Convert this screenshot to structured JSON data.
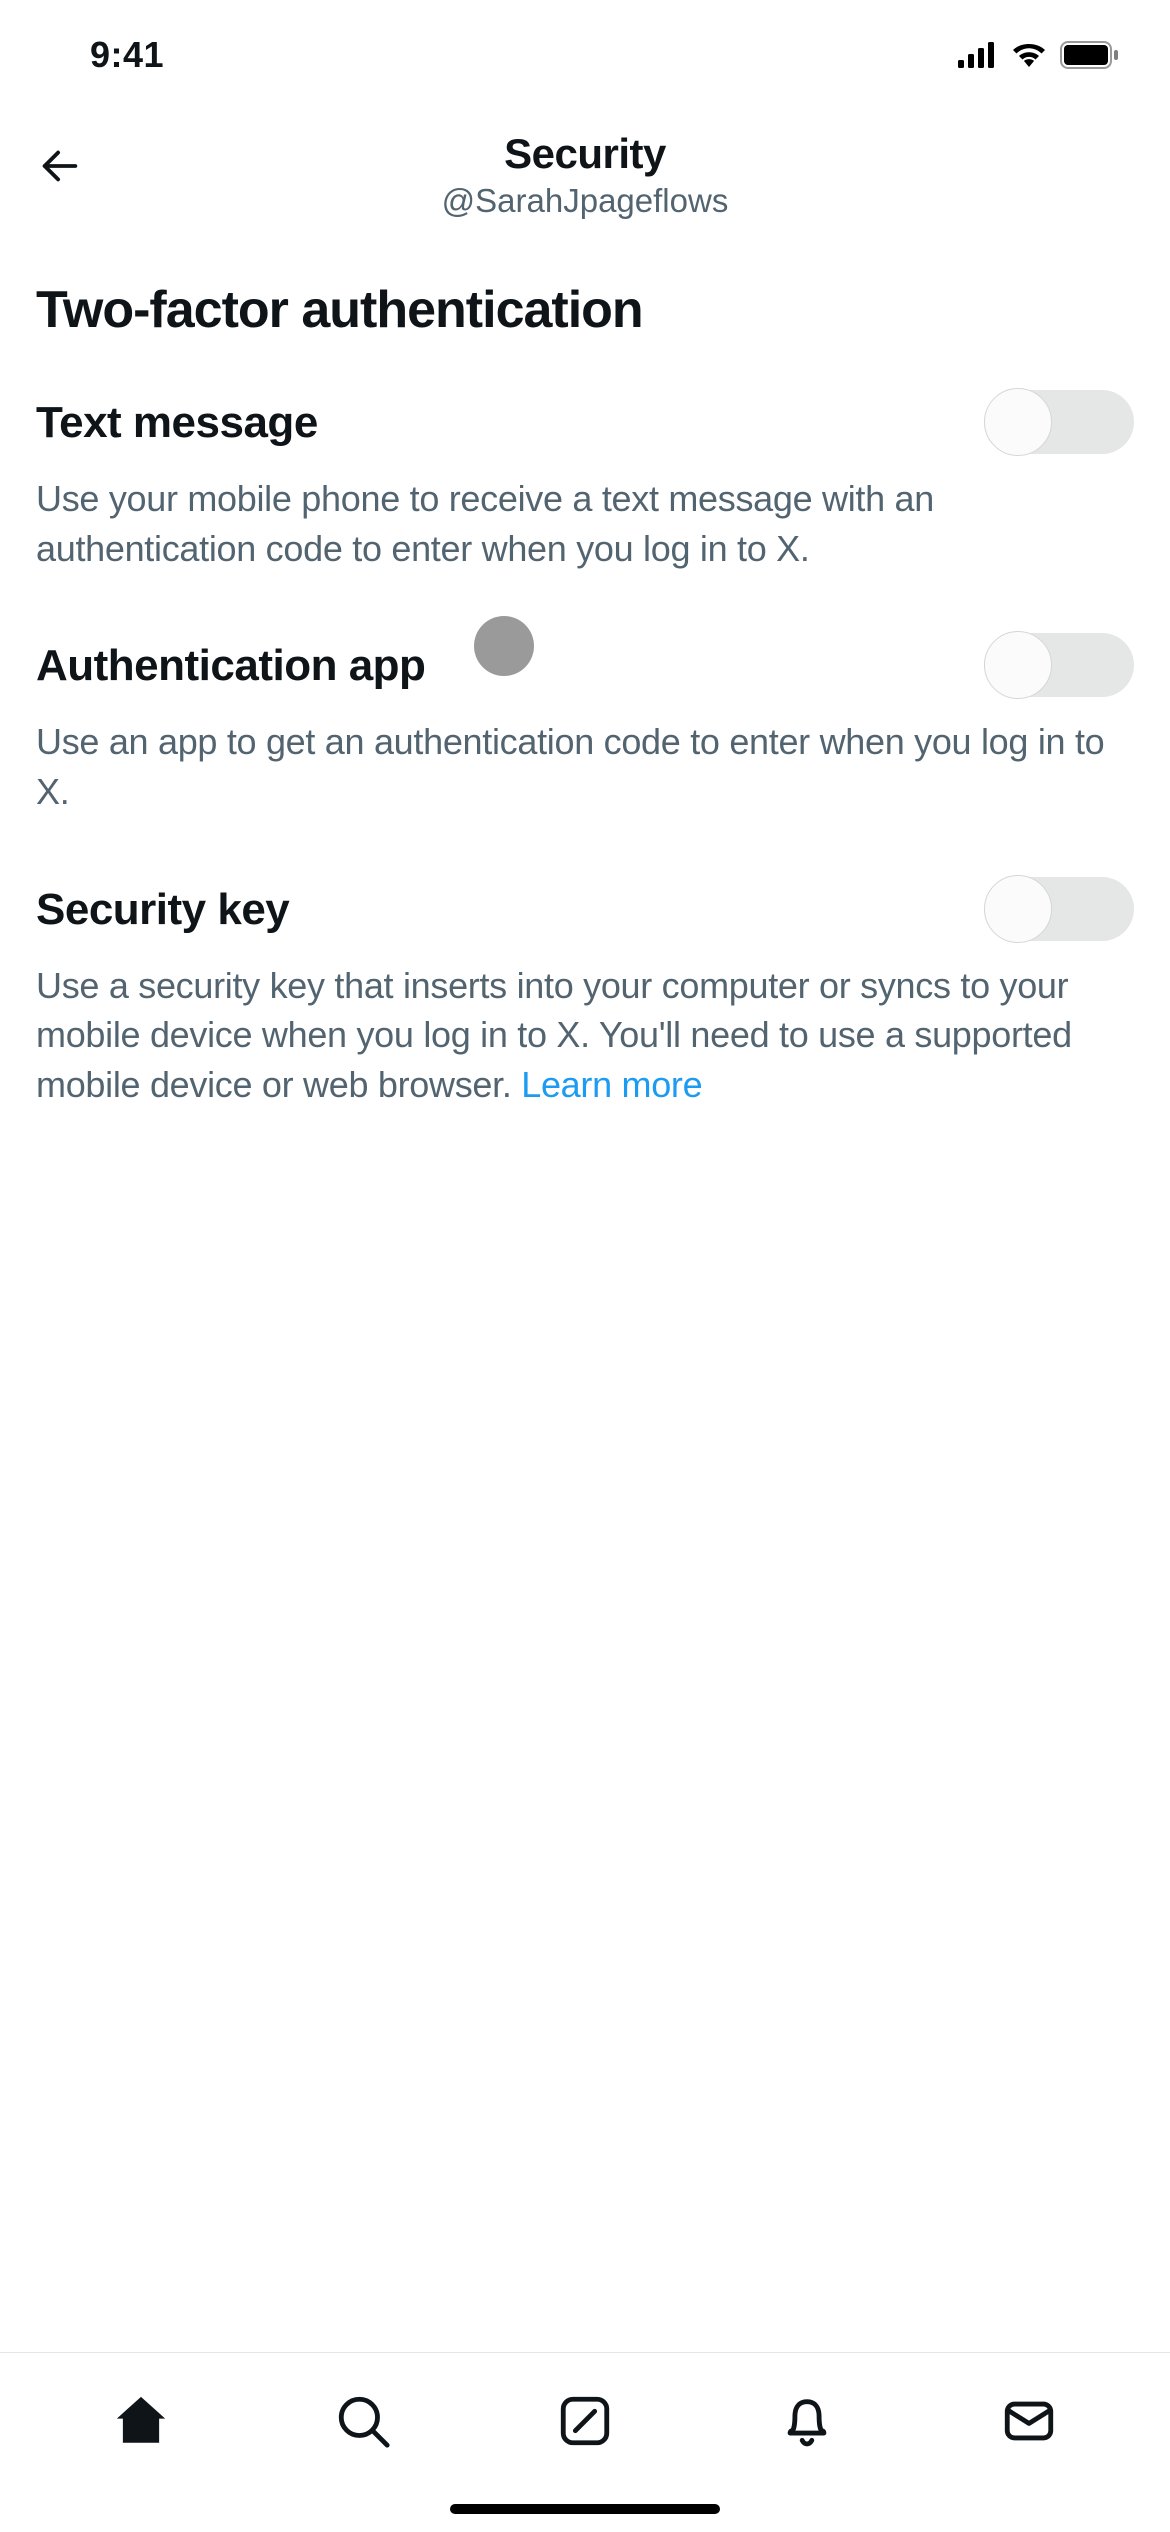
{
  "statusBar": {
    "time": "9:41"
  },
  "header": {
    "title": "Security",
    "subtitle": "@SarahJpageflows"
  },
  "section": {
    "title": "Two-factor authentication"
  },
  "options": [
    {
      "title": "Text message",
      "desc": "Use your mobile phone to receive a text message with an authentication code to enter when you log in to X.",
      "link": ""
    },
    {
      "title": "Authentication app",
      "desc": "Use an app to get an authentication code to enter when you log in to X.",
      "link": ""
    },
    {
      "title": "Security key",
      "desc": "Use a security key that inserts into your computer or syncs to your mobile device when you log in to X. You'll need to use a supported mobile device or web browser. ",
      "link": "Learn more"
    }
  ]
}
